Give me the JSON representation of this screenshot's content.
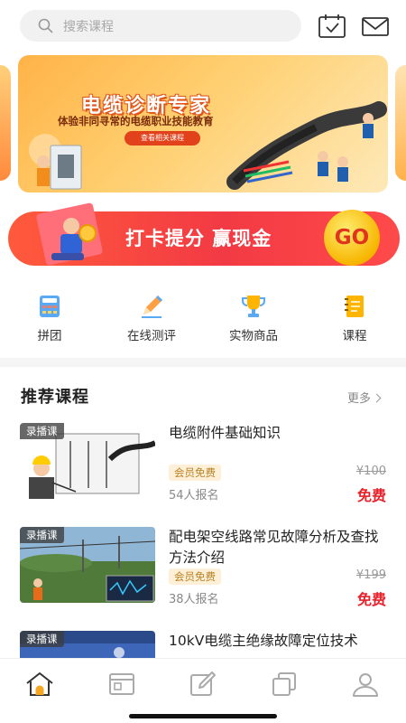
{
  "search": {
    "placeholder": "搜索课程"
  },
  "header": {
    "icons": [
      "calendar-check-icon",
      "mail-icon"
    ]
  },
  "banner": {
    "title": "电缆诊断专家",
    "subtitle": "体验非同寻常的电缆职业技能教育",
    "button_label": "查看相关课程"
  },
  "checkin": {
    "text": "打卡提分 赢现金",
    "button_label": "GO"
  },
  "quick_nav": [
    {
      "label": "拼团",
      "icon": "calculator-icon"
    },
    {
      "label": "在线测评",
      "icon": "pencil-icon"
    },
    {
      "label": "实物商品",
      "icon": "trophy-icon"
    },
    {
      "label": "课程",
      "icon": "notebook-icon"
    }
  ],
  "recommend": {
    "title": "推荐课程",
    "more_label": "更多",
    "courses": [
      {
        "tag": "录播课",
        "title": "电缆附件基础知识",
        "badge": "会员免费",
        "enrolled": "54人报名",
        "original_price": "¥100",
        "price": "免费"
      },
      {
        "tag": "录播课",
        "title": "配电架空线路常见故障分析及查找方法介绍",
        "badge": "会员免费",
        "enrolled": "38人报名",
        "original_price": "¥199",
        "price": "免费"
      },
      {
        "tag": "录播课",
        "title": "10kV电缆主绝缘故障定位技术"
      }
    ]
  },
  "tabbar": {
    "tabs": [
      "home-icon",
      "course-window-icon",
      "edit-icon",
      "copy-icon",
      "user-icon"
    ],
    "active_color": "#f5a623"
  },
  "colors": {
    "accent": "#e8212a",
    "brand_orange": "#ff8a3d"
  }
}
